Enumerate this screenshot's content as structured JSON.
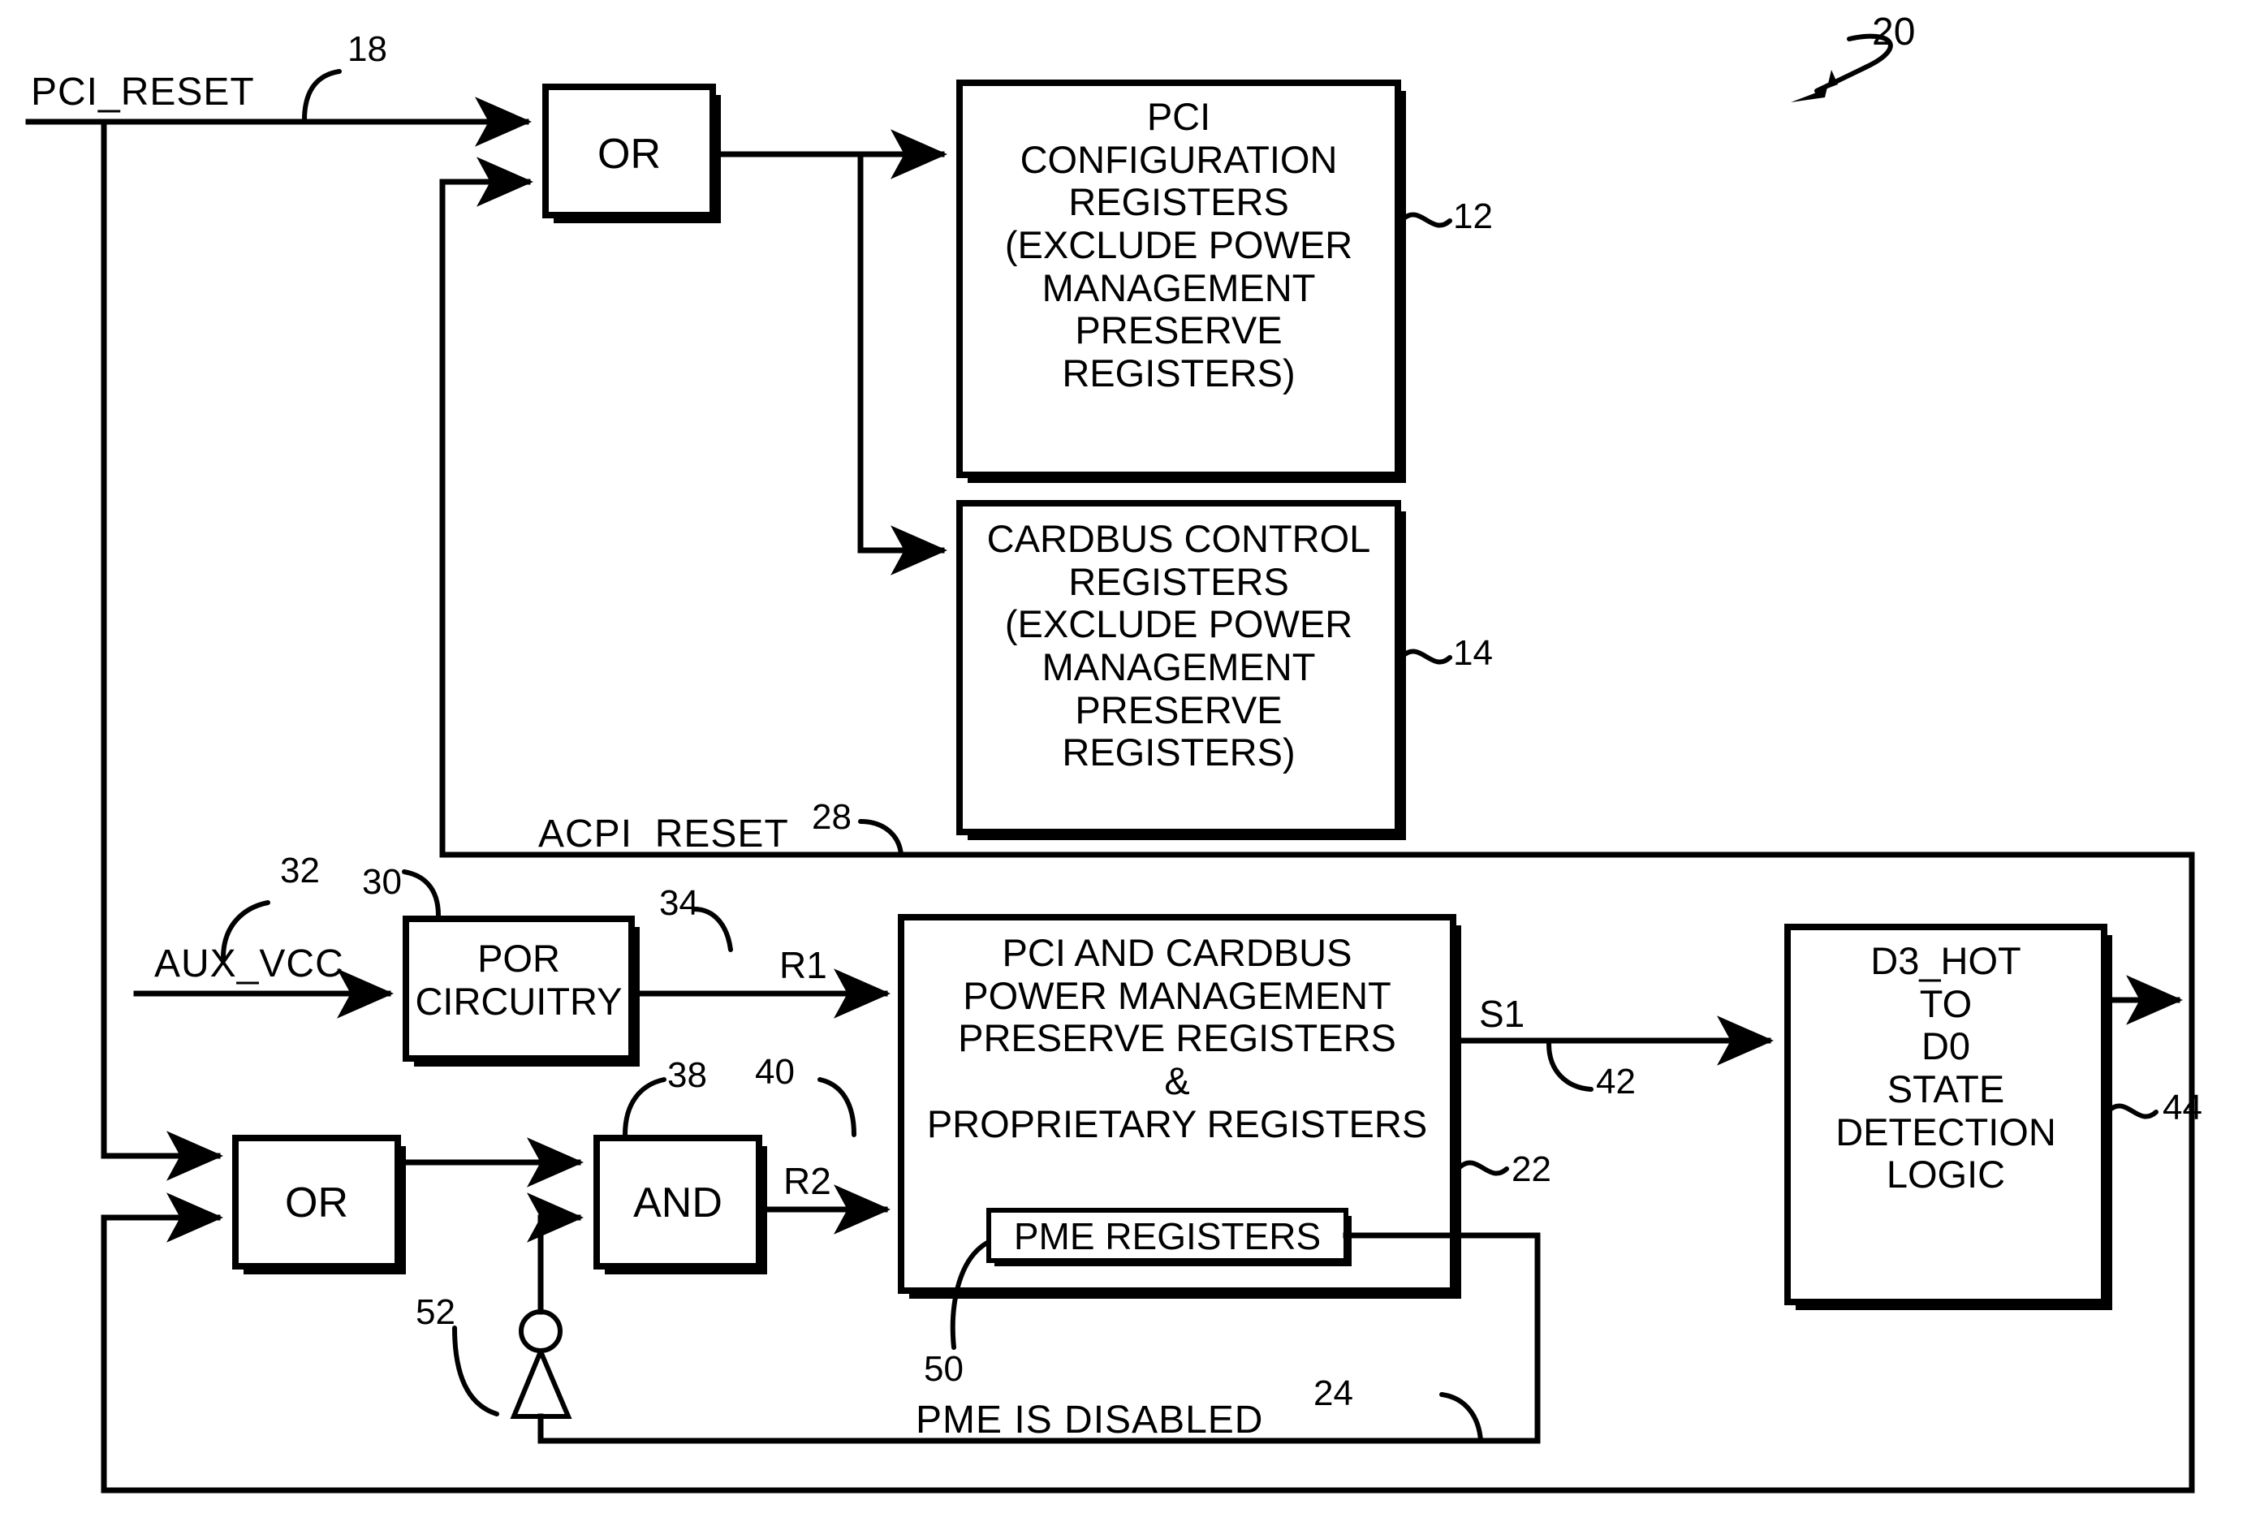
{
  "figure": {
    "figure_ref": "20",
    "reference_numerals": {
      "pci_reset_net": "18",
      "pci_config_registers": "12",
      "cardbus_control_registers": "14",
      "acpi_reset_net": "28",
      "aux_vcc_net": "32",
      "por_circuitry": "30",
      "r1_net": "34",
      "and_gate": "38",
      "r2_net": "40",
      "preserve_registers_block": "22",
      "s1_net": "42",
      "d3hot_logic": "44",
      "pme_registers": "50",
      "inverter": "52",
      "pme_disabled_net": "24"
    }
  },
  "nets": {
    "pci_reset": "PCI_RESET",
    "acpi_reset": "ACPI_RESET",
    "aux_vcc": "AUX_VCC",
    "pme_is_disabled": "PME IS DISABLED",
    "r1": "R1",
    "r2": "R2",
    "s1": "S1"
  },
  "gates": {
    "or_top": "OR",
    "or_bottom": "OR",
    "and": "AND"
  },
  "blocks": {
    "pci_config": {
      "lines": [
        "PCI",
        "CONFIGURATION",
        "REGISTERS",
        "(EXCLUDE POWER",
        "MANAGEMENT",
        "PRESERVE",
        "REGISTERS)"
      ]
    },
    "cardbus_control": {
      "lines": [
        "CARDBUS CONTROL",
        "REGISTERS",
        "(EXCLUDE POWER",
        "MANAGEMENT",
        "PRESERVE",
        "REGISTERS)"
      ]
    },
    "por": {
      "lines": [
        "POR",
        "CIRCUITRY"
      ]
    },
    "preserve": {
      "lines": [
        "PCI AND CARDBUS",
        "POWER MANAGEMENT",
        "PRESERVE REGISTERS",
        "&",
        "PROPRIETARY REGISTERS"
      ],
      "inner_label": "PME REGISTERS"
    },
    "d3hot": {
      "lines": [
        "D3_HOT",
        "TO",
        "D0",
        "STATE",
        "DETECTION",
        "LOGIC"
      ]
    }
  },
  "style": {
    "ink": "#000000",
    "paper": "#ffffff"
  }
}
